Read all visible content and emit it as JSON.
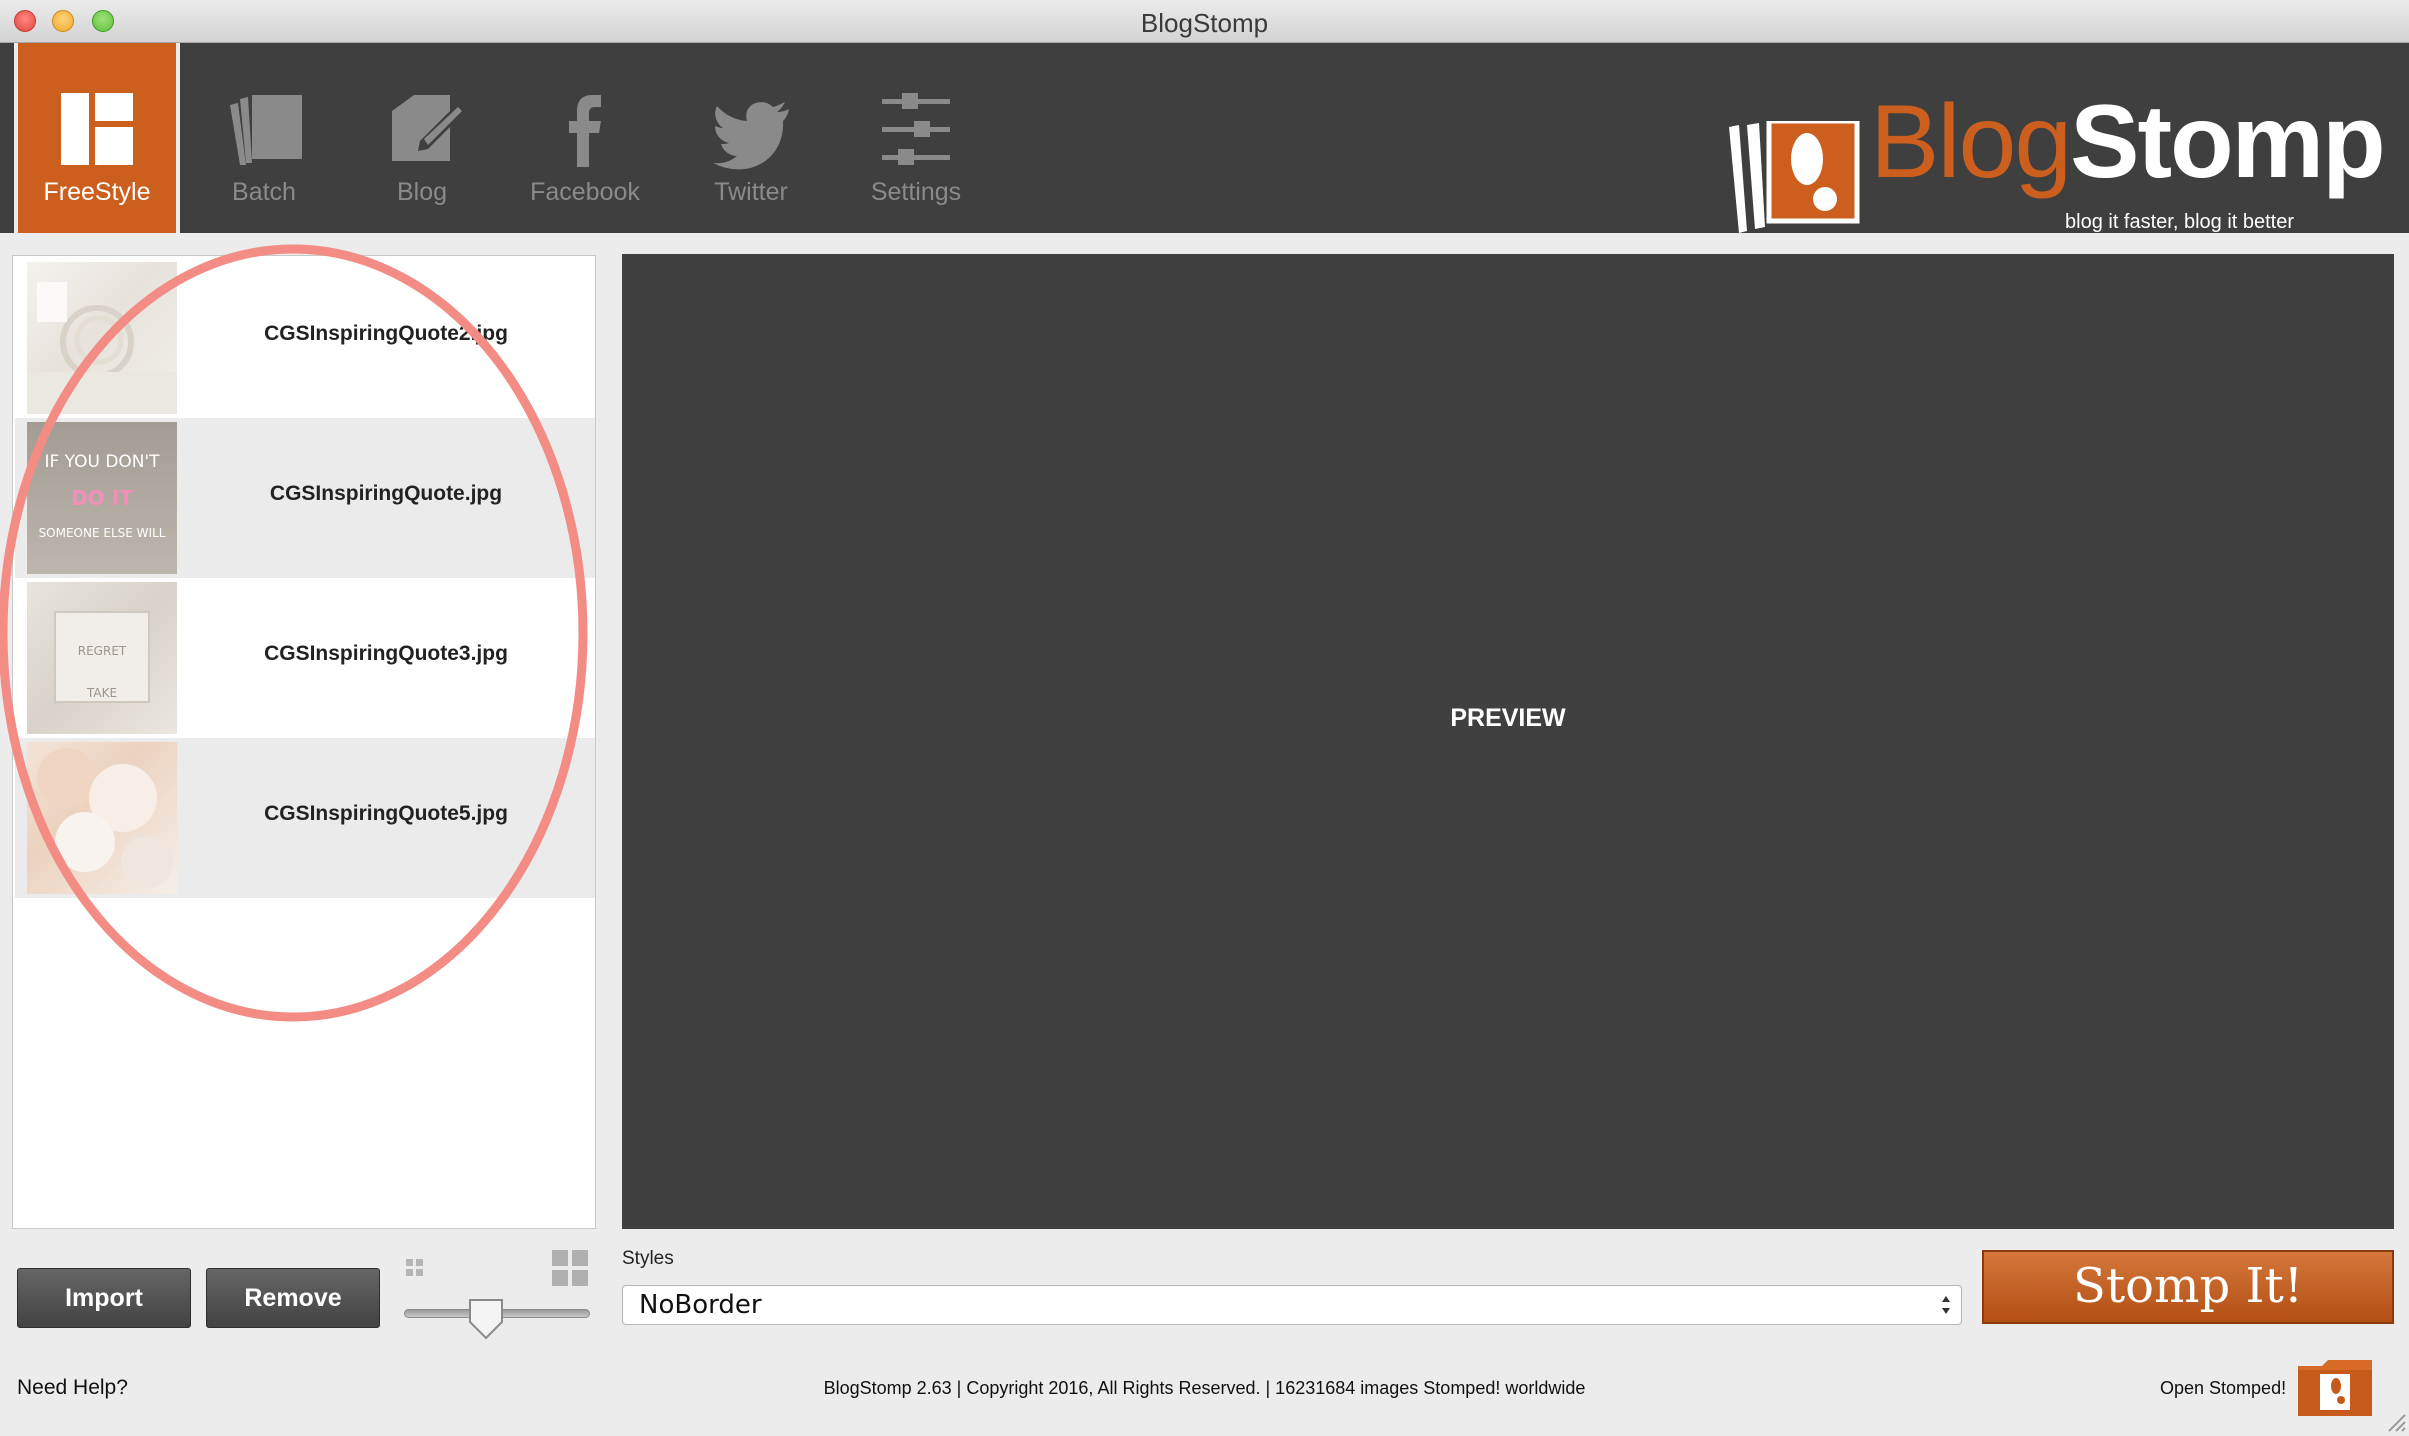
{
  "window": {
    "title": "BlogStomp"
  },
  "toolbar": {
    "items": [
      {
        "label": "FreeStyle",
        "icon": "freestyle-icon",
        "active": true
      },
      {
        "label": "Batch",
        "icon": "batch-icon",
        "active": false
      },
      {
        "label": "Blog",
        "icon": "blog-edit-icon",
        "active": false
      },
      {
        "label": "Facebook",
        "icon": "facebook-icon",
        "active": false
      },
      {
        "label": "Twitter",
        "icon": "twitter-icon",
        "active": false
      },
      {
        "label": "Settings",
        "icon": "settings-sliders-icon",
        "active": false
      }
    ]
  },
  "logo": {
    "word_blog": "Blog",
    "word_stomp": "Stomp",
    "tagline": "blog it faster, blog it better"
  },
  "files": [
    {
      "name": "CGSInspiringQuote2.jpg",
      "thumb_lines": []
    },
    {
      "name": "CGSInspiringQuote.jpg",
      "thumb_lines": [
        "IF YOU DON'T",
        "DO IT",
        "SOMEONE ELSE WILL"
      ]
    },
    {
      "name": "CGSInspiringQuote3.jpg",
      "thumb_lines": [
        "REGRET",
        "TAKE"
      ]
    },
    {
      "name": "CGSInspiringQuote5.jpg",
      "thumb_lines": []
    }
  ],
  "preview": {
    "label": "PREVIEW"
  },
  "buttons": {
    "import": "Import",
    "remove": "Remove",
    "stomp": "Stomp It!"
  },
  "styles": {
    "label": "Styles",
    "selected": "NoBorder"
  },
  "footer": {
    "help": "Need Help?",
    "copyright": "BlogStomp 2.63 | Copyright 2016, All Rights Reserved. | 16231684 images Stomped! worldwide",
    "open_stomped": "Open Stomped!"
  },
  "colors": {
    "accent": "#cc5f1e",
    "toolbar_bg": "#3f3f3f",
    "preview_bg": "#404040",
    "annotation": "#f28c85"
  }
}
